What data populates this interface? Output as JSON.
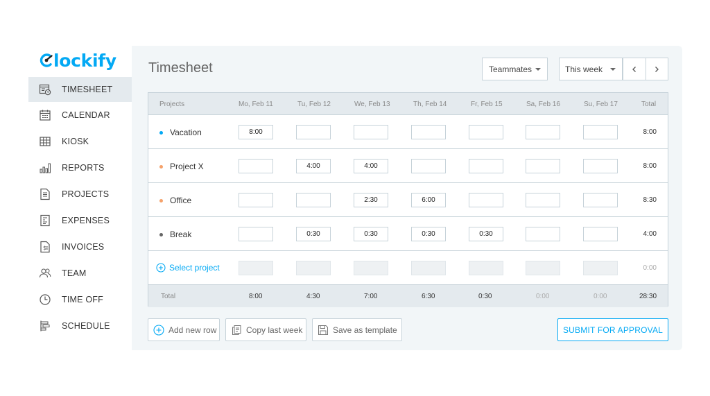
{
  "app": {
    "logo_text": "lockify",
    "brand_color": "#03a9f4"
  },
  "sidebar": {
    "items": [
      {
        "label": "TIMESHEET",
        "icon": "timesheet-icon",
        "active": true
      },
      {
        "label": "CALENDAR",
        "icon": "calendar-icon"
      },
      {
        "label": "KIOSK",
        "icon": "kiosk-icon"
      },
      {
        "label": "REPORTS",
        "icon": "reports-icon"
      },
      {
        "label": "PROJECTS",
        "icon": "projects-icon"
      },
      {
        "label": "EXPENSES",
        "icon": "expenses-icon"
      },
      {
        "label": "INVOICES",
        "icon": "invoices-icon"
      },
      {
        "label": "TEAM",
        "icon": "team-icon"
      },
      {
        "label": "TIME OFF",
        "icon": "time-off-icon"
      },
      {
        "label": "SCHEDULE",
        "icon": "schedule-icon"
      }
    ]
  },
  "header": {
    "title": "Timesheet",
    "teammates": "Teammates",
    "week": "This week"
  },
  "table": {
    "columns": [
      "Projects",
      "Mo, Feb 11",
      "Tu, Feb 12",
      "We, Feb 13",
      "Th, Feb 14",
      "Fr, Feb 15",
      "Sa, Feb 16",
      "Su, Feb 17",
      "Total"
    ],
    "rows": [
      {
        "project": "Vacation",
        "color": "#03a9f4",
        "cells": [
          "8:00",
          "",
          "",
          "",
          "",
          "",
          ""
        ],
        "total": "8:00"
      },
      {
        "project": "Project X",
        "color": "#f5a26b",
        "cells": [
          "",
          "4:00",
          "4:00",
          "",
          "",
          "",
          ""
        ],
        "total": "8:00"
      },
      {
        "project": "Office",
        "color": "#f5a26b",
        "cells": [
          "",
          "",
          "2:30",
          "6:00",
          "",
          "",
          ""
        ],
        "total": "8:30"
      },
      {
        "project": "Break",
        "color": "#666666",
        "cells": [
          "",
          "0:30",
          "0:30",
          "0:30",
          "0:30",
          "",
          ""
        ],
        "total": "4:00"
      }
    ],
    "select_project": "Select project",
    "select_total": "0:00",
    "footer": {
      "label": "Total",
      "values": [
        "8:00",
        "4:30",
        "7:00",
        "6:30",
        "0:30",
        "0:00",
        "0:00"
      ],
      "total": "28:30"
    }
  },
  "actions": {
    "add_row": "Add new row",
    "copy_week": "Copy last week",
    "save_template": "Save as template",
    "submit": "SUBMIT FOR APPROVAL"
  }
}
